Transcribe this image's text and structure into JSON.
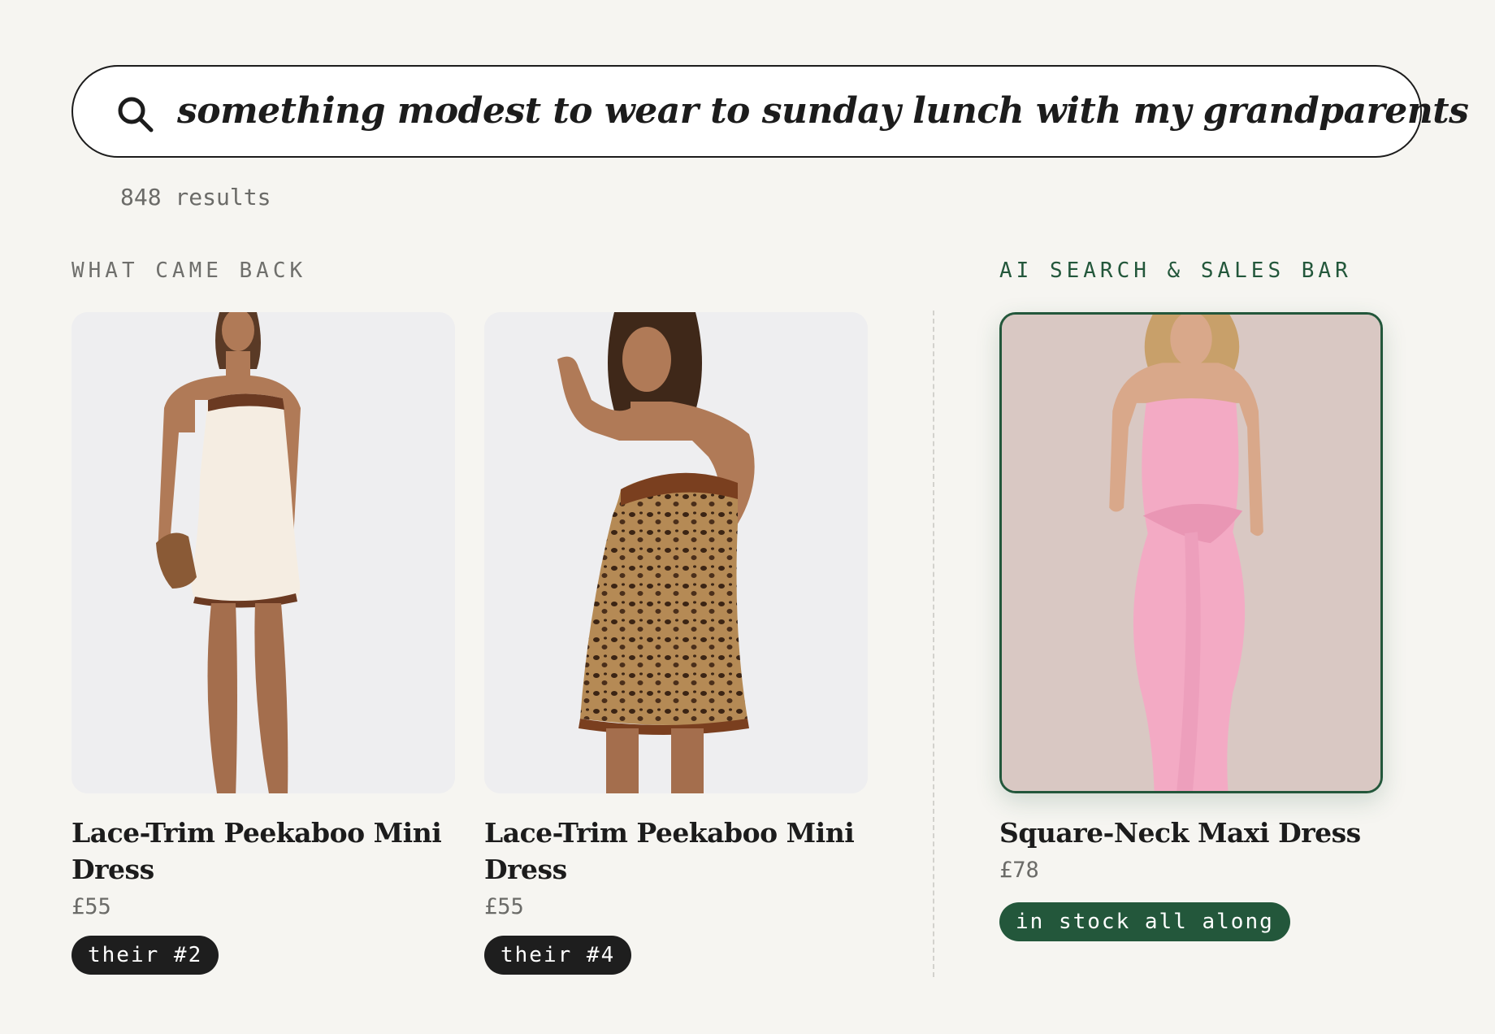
{
  "search": {
    "query": "something modest to wear to sunday lunch with my grandparents",
    "icon": "search-icon"
  },
  "results": {
    "count_label": "848 results"
  },
  "sections": {
    "left_label": "WHAT CAME BACK",
    "right_label": "AI SEARCH & SALES BAR"
  },
  "products": [
    {
      "name": "Lace-Trim Peekaboo Mini Dress",
      "price": "£55",
      "badge": "their #2",
      "image": "cream-mini-dress-photo"
    },
    {
      "name": "Lace-Trim Peekaboo Mini Dress",
      "price": "£55",
      "badge": "their #4",
      "image": "leopard-mini-dress-photo"
    },
    {
      "name": "Square-Neck Maxi Dress",
      "price": "£78",
      "badge": "in stock all along",
      "image": "pink-maxi-dress-photo"
    }
  ],
  "colors": {
    "background": "#f6f5f1",
    "accent_green": "#23573b",
    "badge_dark": "#1e1e1e",
    "muted_text": "#6b6b68"
  }
}
